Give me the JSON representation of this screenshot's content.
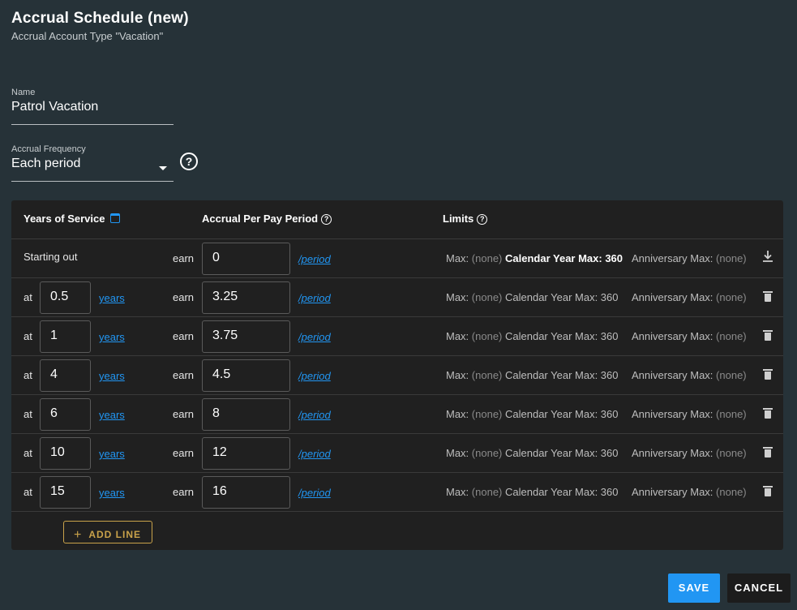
{
  "header": {
    "title": "Accrual Schedule (new)",
    "subtitle": "Accrual Account Type \"Vacation\""
  },
  "name_field": {
    "label": "Name",
    "value": "Patrol Vacation"
  },
  "frequency_field": {
    "label": "Accrual Frequency",
    "value": "Each period",
    "help": "?"
  },
  "table": {
    "headers": {
      "years": "Years of Service",
      "accrual": "Accrual Per Pay Period",
      "limits": "Limits"
    },
    "first_row": {
      "label": "Starting out",
      "earn_label": "earn",
      "earn_value": "0",
      "period_link": "/period",
      "max_label": "Max:",
      "max_value": "(none)",
      "cy_max": "Calendar Year Max: 360",
      "ann_label": "Anniversary Max:",
      "ann_value": "(none)"
    },
    "rows": [
      {
        "at": "at",
        "years": "0.5",
        "years_link": "years",
        "earn_label": "earn",
        "earn": "3.25",
        "period_link": "/period",
        "max_label": "Max:",
        "max_value": "(none)",
        "cy_max": "Calendar Year Max: 360",
        "ann_label": "Anniversary Max:",
        "ann_value": "(none)"
      },
      {
        "at": "at",
        "years": "1",
        "years_link": "years",
        "earn_label": "earn",
        "earn": "3.75",
        "period_link": "/period",
        "max_label": "Max:",
        "max_value": "(none)",
        "cy_max": "Calendar Year Max: 360",
        "ann_label": "Anniversary Max:",
        "ann_value": "(none)"
      },
      {
        "at": "at",
        "years": "4",
        "years_link": "years",
        "earn_label": "earn",
        "earn": "4.5",
        "period_link": "/period",
        "max_label": "Max:",
        "max_value": "(none)",
        "cy_max": "Calendar Year Max: 360",
        "ann_label": "Anniversary Max:",
        "ann_value": "(none)"
      },
      {
        "at": "at",
        "years": "6",
        "years_link": "years",
        "earn_label": "earn",
        "earn": "8",
        "period_link": "/period",
        "max_label": "Max:",
        "max_value": "(none)",
        "cy_max": "Calendar Year Max: 360",
        "ann_label": "Anniversary Max:",
        "ann_value": "(none)"
      },
      {
        "at": "at",
        "years": "10",
        "years_link": "years",
        "earn_label": "earn",
        "earn": "12",
        "period_link": "/period",
        "max_label": "Max:",
        "max_value": "(none)",
        "cy_max": "Calendar Year Max: 360",
        "ann_label": "Anniversary Max:",
        "ann_value": "(none)"
      },
      {
        "at": "at",
        "years": "15",
        "years_link": "years",
        "earn_label": "earn",
        "earn": "16",
        "period_link": "/period",
        "max_label": "Max:",
        "max_value": "(none)",
        "cy_max": "Calendar Year Max: 360",
        "ann_label": "Anniversary Max:",
        "ann_value": "(none)"
      }
    ],
    "add_line": "ADD LINE"
  },
  "buttons": {
    "save": "SAVE",
    "cancel": "CANCEL"
  },
  "colors": {
    "accent": "#2196f3",
    "add_line": "#c9a24a",
    "background": "#263238",
    "card": "#202020"
  },
  "icons": [
    "calendar-icon",
    "help-icon",
    "download-icon",
    "trash-icon",
    "plus-icon",
    "dropdown-caret-icon"
  ]
}
